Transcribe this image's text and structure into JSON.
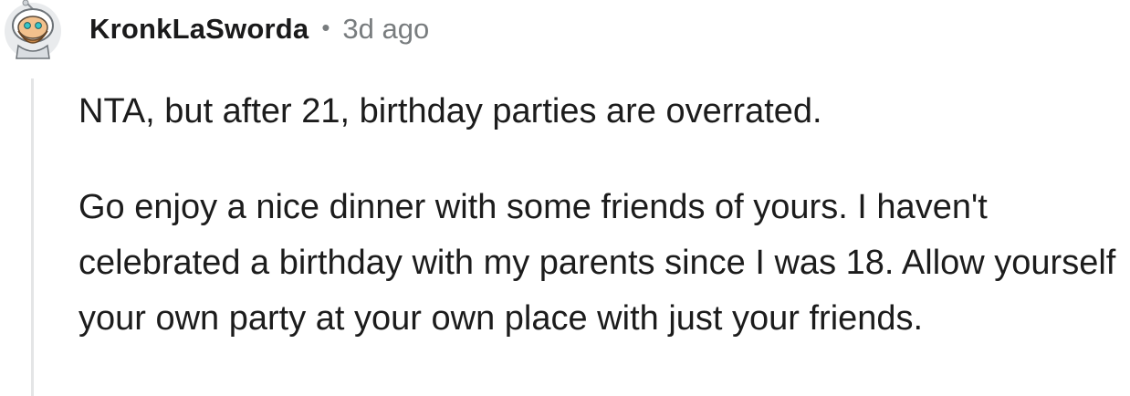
{
  "comment": {
    "username": "KronkLaSworda",
    "separator": "•",
    "timestamp": "3d ago",
    "paragraphs": [
      "NTA, but after 21, birthday parties are overrated.",
      "Go enjoy a nice dinner with some friends of yours. I haven't celebrated a birthday with my parents since I was 18. Allow yourself your own party at your own place with just your friends."
    ],
    "avatar_icon": "snoo-avatar-icon"
  },
  "colors": {
    "username": "#1a1a1b",
    "meta": "#787c7e",
    "body_text": "#1c1c1c",
    "thread_line": "#e4e5e6"
  }
}
